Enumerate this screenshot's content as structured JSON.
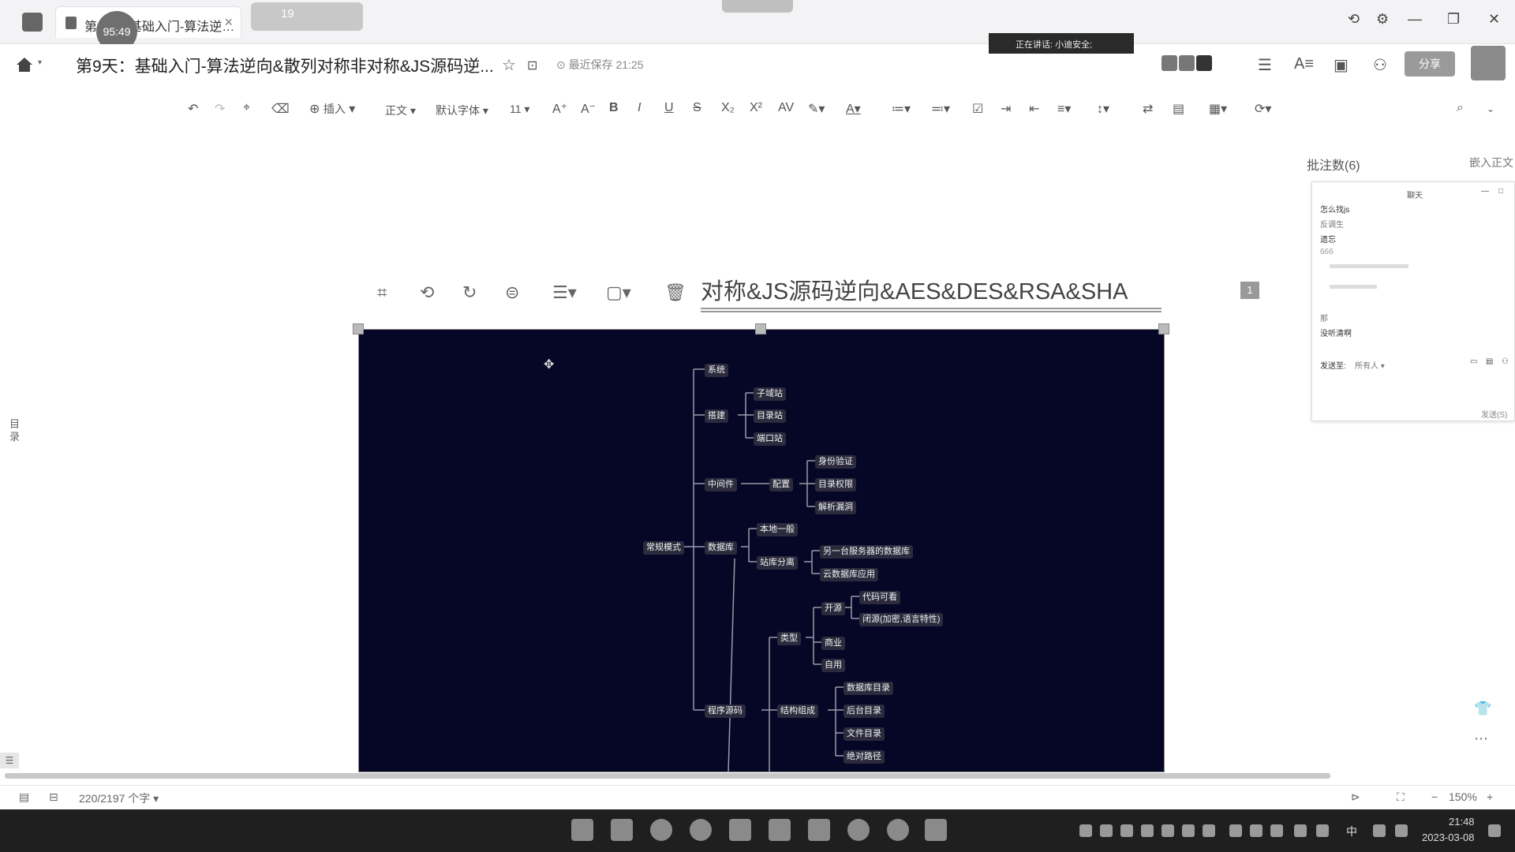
{
  "window": {
    "tab_label": "第9天：基础入门-算法逆…",
    "tab_close": "×",
    "timer_badge": "95:49",
    "blurred_tab_count": "19",
    "controls": [
      "⟲",
      "⚙",
      "—",
      "❐",
      "✕"
    ]
  },
  "doc_header": {
    "title": "第9天：基础入门-算法逆向&散列对称非对称&JS源码逆...",
    "save_status": "最近保存 21:25",
    "speaking_banner": "正在讲话: 小迪安全;",
    "share_label": "分享"
  },
  "toolbar": {
    "insert_label": "插入",
    "style_label": "正文",
    "font_label": "默认字体",
    "size_label": "11"
  },
  "editor": {
    "outline_label": "目录",
    "heading_fragment": "对称&JS源码逆向&AES&DES&RSA&SHA",
    "page_number": "1"
  },
  "mindmap": {
    "root": "常规模式",
    "branches": [
      {
        "label": "系统",
        "children": []
      },
      {
        "label": "搭建",
        "children": [
          {
            "label": "子域站"
          },
          {
            "label": "目录站"
          },
          {
            "label": "端口站"
          }
        ]
      },
      {
        "label": "中间件",
        "children": [
          {
            "label": "配置",
            "children": [
              "身份验证",
              "目录权限",
              "解析漏洞"
            ]
          }
        ]
      },
      {
        "label": "数据库",
        "children": [
          {
            "label": "本地一般"
          },
          {
            "label": "站库分离",
            "children": [
              "另一台服务器的数据库",
              "云数据库应用"
            ]
          }
        ]
      },
      {
        "label": "程序源码",
        "children": [
          {
            "label": "类型",
            "children": [
              {
                "label": "开源",
                "children": [
                  "代码可看",
                  "闭源(加密,语言特性)"
                ]
              },
              {
                "label": "商业"
              },
              {
                "label": "自用"
              }
            ]
          },
          {
            "label": "结构组成",
            "children": [
              "数据库目录",
              "后台目录",
              "文件目录",
              "绝对路径"
            ]
          }
        ]
      }
    ]
  },
  "right_panel": {
    "title": "批注数(6)",
    "embed_link": "嵌入正文",
    "chat": {
      "header": "聊天",
      "lines": [
        "怎么找js",
        "反调生",
        "遗忘",
        "666",
        "那",
        "没听清啊"
      ],
      "send_to_label": "发送至:",
      "send_to_value": "所有人",
      "send_button": "发送(S)"
    }
  },
  "statusbar": {
    "word_count": "220/2197 个字",
    "zoom": "150%"
  },
  "taskbar": {
    "ime": "中",
    "time": "21:48",
    "date": "2023-03-08"
  }
}
